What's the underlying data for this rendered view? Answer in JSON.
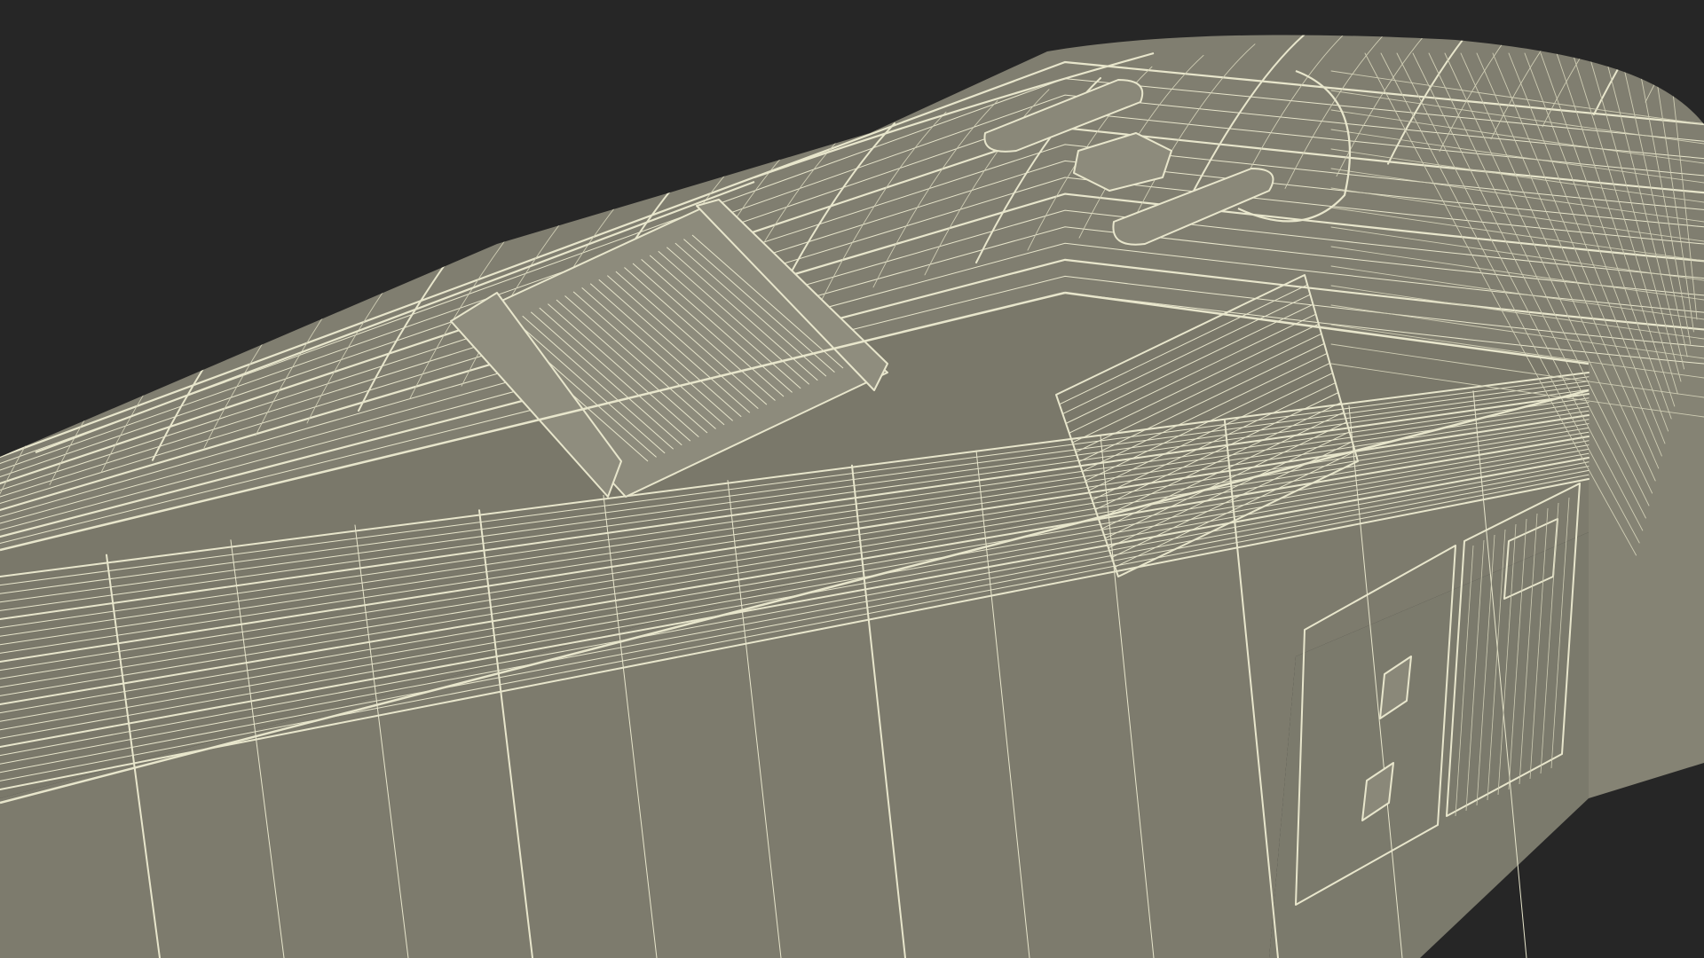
{
  "scene": {
    "subject": "locomotive-body-wireframe",
    "colors": {
      "background": "#262626",
      "surface": "#7f7d6f",
      "surface_light": "#8a8879",
      "surface_dark": "#6d6b5e",
      "deep_shadow": "#5a594e",
      "wire": "#e8e6cc",
      "wire_faint": "#cfcdb4"
    }
  }
}
